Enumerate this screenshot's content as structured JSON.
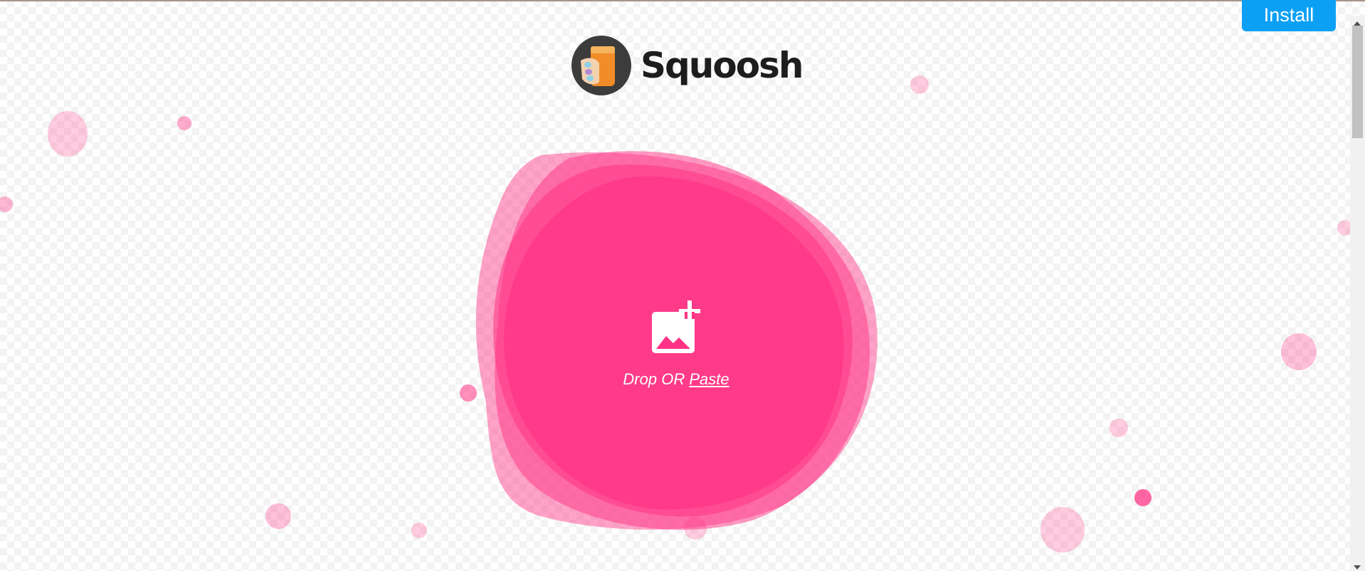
{
  "header": {
    "logo_text": "Squoosh",
    "install_label": "Install"
  },
  "drop_area": {
    "icon": "add-image-icon",
    "drop_text": "Drop OR",
    "paste_label": "Paste"
  },
  "colors": {
    "accent_pink": "#ff3385",
    "install_blue": "#0ca0f5",
    "logo_text": "#1d1d1d"
  }
}
